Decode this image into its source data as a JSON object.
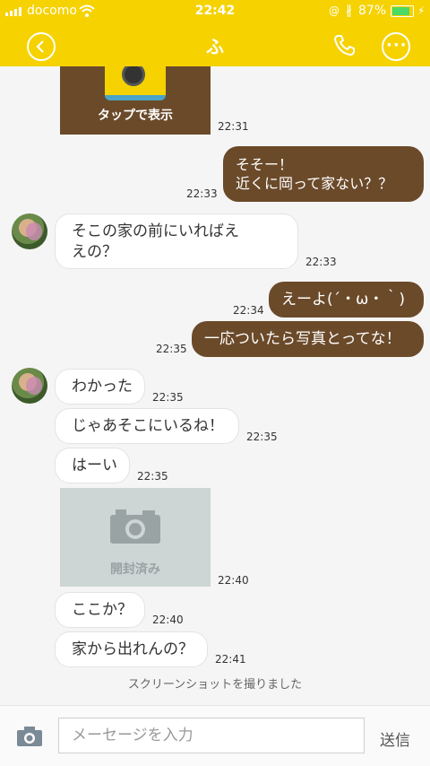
{
  "status": {
    "carrier": "docomo",
    "time": "22:42",
    "battery": "87%"
  },
  "header": {
    "title": "ふ"
  },
  "messages": {
    "m0": {
      "image_label": "タップで表示",
      "time": "22:31"
    },
    "m1": {
      "text": "そそー！\n近くに岡って家ない？？",
      "time": "22:33"
    },
    "m2": {
      "text": "そこの家の前にいればえ\nえの？",
      "time": "22:33"
    },
    "m3": {
      "text": "えーよ(´・ω・｀)",
      "time": "22:34"
    },
    "m4": {
      "text": "一応ついたら写真とってな！",
      "time": "22:35"
    },
    "m5": {
      "text": "わかった",
      "time": "22:35"
    },
    "m6": {
      "text": "じゃあそこにいるね！",
      "time": "22:35"
    },
    "m7": {
      "text": "はーい",
      "time": "22:35"
    },
    "m8": {
      "image_label": "開封済み",
      "time": "22:40"
    },
    "m9": {
      "text": "ここか？",
      "time": "22:40"
    },
    "m10": {
      "text": "家から出れんの？",
      "time": "22:41"
    }
  },
  "system_notice": "スクリーンショットを撮りました",
  "input": {
    "placeholder": "メーセージを入力",
    "send_label": "送信"
  },
  "colors": {
    "header": "#f5d200",
    "outgoing": "#6b4a2a",
    "incoming": "#ffffff"
  }
}
